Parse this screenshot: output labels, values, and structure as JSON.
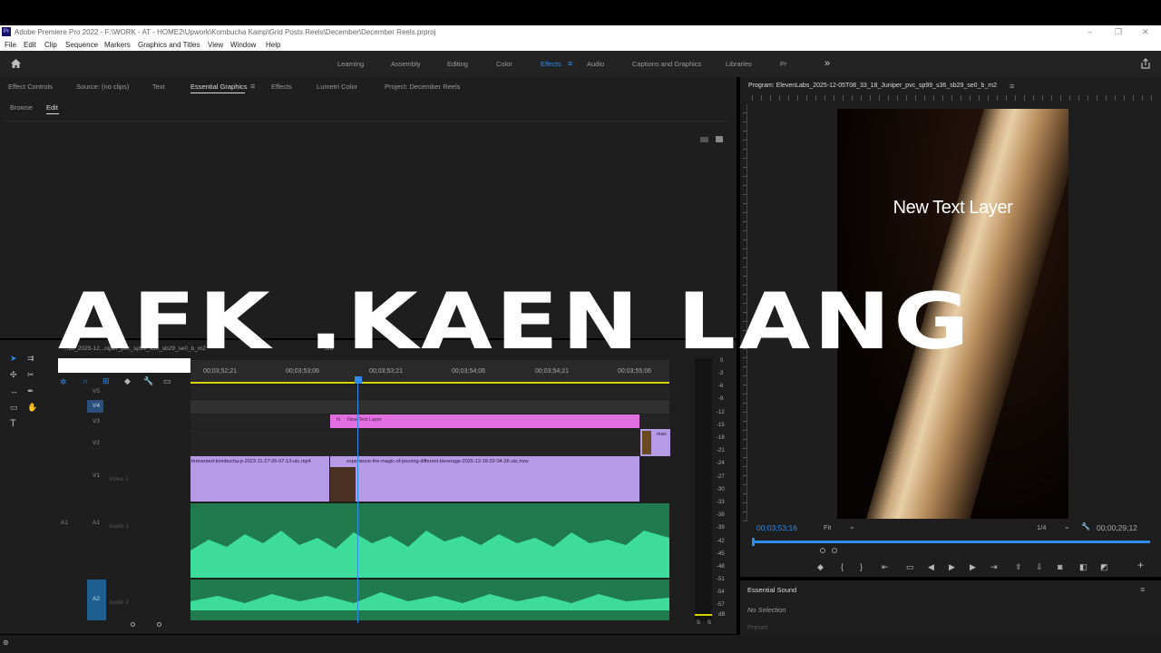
{
  "window": {
    "title": "Adobe Premiere Pro 2022 - F:\\WORK - AT - HOME2\\Upwork\\Kombucha Kamp\\Grid Posts Reels\\December\\December Reels.prproj"
  },
  "menu": [
    "File",
    "Edit",
    "Clip",
    "Sequence",
    "Markers",
    "Graphics and Titles",
    "View",
    "Window",
    "Help"
  ],
  "workspaces": [
    "Learning",
    "Assembly",
    "Editing",
    "Color",
    "Effects",
    "Audio",
    "Captions and Graphics",
    "Libraries",
    "Pr"
  ],
  "active_workspace": "Effects",
  "left_tabs": [
    "Effect Controls",
    "Source: (no clips)",
    "Text",
    "Essential Graphics",
    "Effects",
    "Lumetri Color",
    "Project: December Reels"
  ],
  "eg_subtabs": [
    "Browse",
    "Edit"
  ],
  "program": {
    "title": "Program: ElevenLabs_2025-12-05T08_33_18_Juniper_pvc_sp99_s36_sb29_se0_b_m2",
    "overlay_text": "New Text Layer",
    "timecode": "00;03;53;16",
    "fit": "Fit",
    "resolution": "1/4",
    "duration": "00;00;29;12"
  },
  "sequence_tabs": [
    "...bs_2025-12...niper_pvc_sp99_s36_sb29_se0_b_m2",
    "3rd"
  ],
  "timeline": {
    "ruler": [
      "00;03;52;21",
      "00;03;53;06",
      "00;03;53;21",
      "00;03;54;06",
      "00;03;54;21",
      "00;03;55;06"
    ],
    "video_tracks": [
      "V5",
      "V4",
      "V3",
      "V2",
      "V1"
    ],
    "audio_tracks": [
      "A1",
      "A2"
    ],
    "v1_name": "Video 1",
    "a1_name": "Audio 1",
    "a2_name": "Audio 2",
    "clips": {
      "text_layer": "New Text Layer",
      "v1a": "fermented-kombucha-p-2023-11-27-05-07-13-utc.mp4",
      "v1b": "experience-the-magic-of-pouring-different-beverage-2025-12-18-02-04-26-utc.mov",
      "v2": "man"
    }
  },
  "meter": {
    "scale": [
      "0",
      "-3",
      "-6",
      "-9",
      "-12",
      "-15",
      "-18",
      "-21",
      "-24",
      "-27",
      "-30",
      "-33",
      "-36",
      "-39",
      "-42",
      "-45",
      "-48",
      "-51",
      "-54",
      "-57",
      "dB"
    ],
    "solo": "S",
    "solo2": "S"
  },
  "essential_sound": {
    "title": "Essential Sound",
    "status": "No Selection",
    "preset_label": "Preset:"
  },
  "overlay_caption": "AFK .KAEN LANG"
}
